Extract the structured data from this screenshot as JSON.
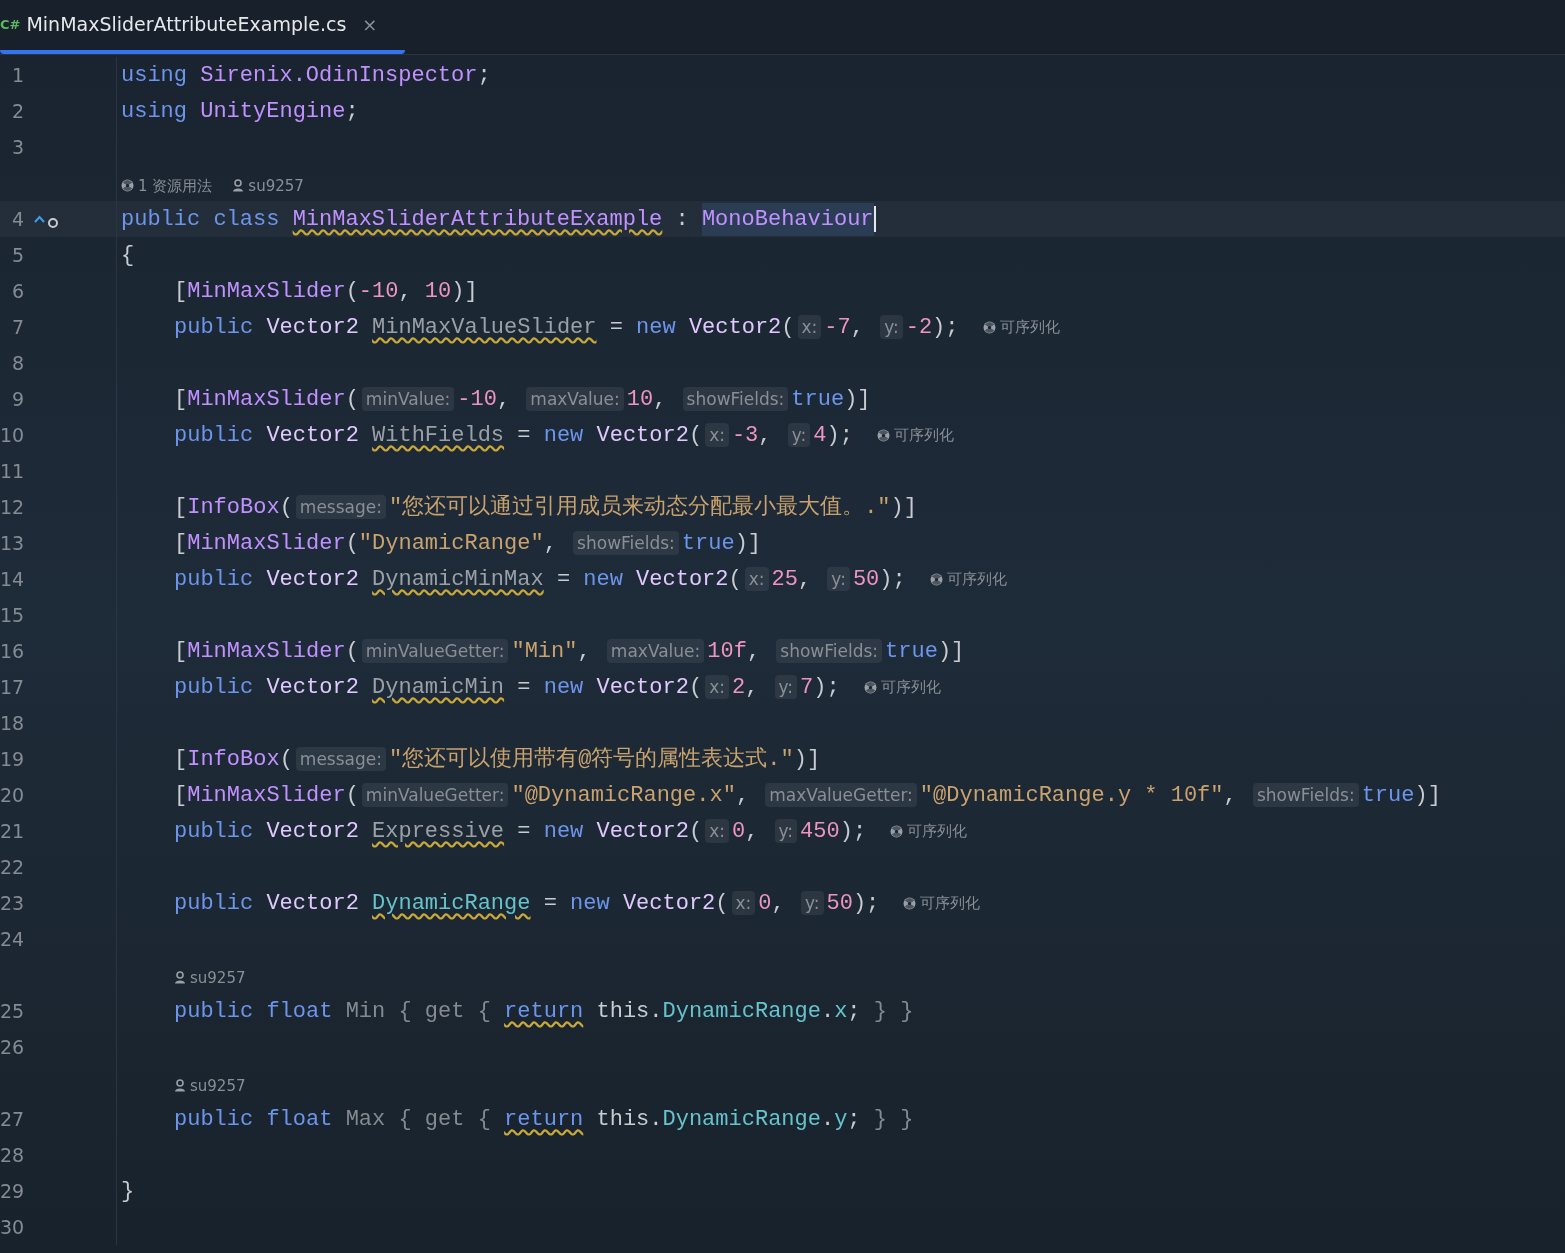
{
  "tab": {
    "icon_text": "C#",
    "title": "MinMaxSliderAttributeExample.cs",
    "close": "×",
    "selected": true
  },
  "rows": [
    {
      "kind": "code",
      "number": "1",
      "tokens": [
        {
          "kind": "keyword",
          "text": "using "
        },
        {
          "kind": "type",
          "text": "Sirenix.OdinInspector"
        },
        {
          "kind": "plain",
          "text": ";"
        }
      ]
    },
    {
      "kind": "code",
      "number": "2",
      "tokens": [
        {
          "kind": "keyword",
          "text": "using "
        },
        {
          "kind": "type",
          "text": "UnityEngine"
        },
        {
          "kind": "plain",
          "text": ";"
        }
      ]
    },
    {
      "kind": "code",
      "number": "3",
      "tokens": []
    },
    {
      "kind": "lens",
      "items": [
        {
          "kind": "usages",
          "text": "1 资源用法"
        },
        {
          "kind": "author",
          "text": "su9257"
        }
      ]
    },
    {
      "kind": "current_code",
      "number": "4",
      "tokens": [
        {
          "kind": "keyword",
          "text": "public class "
        },
        {
          "kind": "type_squiggle",
          "text": "MinMaxSliderAttributeExample"
        },
        {
          "kind": "plain",
          "text": " : "
        },
        {
          "kind": "type_highlight",
          "text": "MonoBehaviour"
        }
      ]
    },
    {
      "kind": "code",
      "number": "5",
      "tokens": [
        {
          "kind": "plain",
          "text": "{"
        }
      ]
    },
    {
      "kind": "indented_code",
      "number": "6",
      "tokens": [
        {
          "kind": "plain",
          "text": "["
        },
        {
          "kind": "type",
          "text": "MinMaxSlider"
        },
        {
          "kind": "plain",
          "text": "("
        },
        {
          "kind": "number",
          "text": "-10"
        },
        {
          "kind": "plain",
          "text": ", "
        },
        {
          "kind": "number",
          "text": "10"
        },
        {
          "kind": "plain",
          "text": ")]"
        }
      ]
    },
    {
      "kind": "indented_code",
      "number": "7",
      "tokens": [
        {
          "kind": "keyword",
          "text": "public "
        },
        {
          "kind": "struct",
          "text": "Vector2 "
        },
        {
          "kind": "field_squiggle",
          "text": "MinMaxValueSlider"
        },
        {
          "kind": "plain",
          "text": " = "
        },
        {
          "kind": "keyword",
          "text": "new "
        },
        {
          "kind": "struct",
          "text": "Vector2"
        },
        {
          "kind": "plain",
          "text": "("
        },
        {
          "kind": "hint",
          "text": "x:"
        },
        {
          "kind": "number",
          "text": "-7"
        },
        {
          "kind": "plain",
          "text": ", "
        },
        {
          "kind": "hint",
          "text": "y:"
        },
        {
          "kind": "number",
          "text": "-2"
        },
        {
          "kind": "plain",
          "text": ");"
        },
        {
          "kind": "lens",
          "text": "可序列化"
        }
      ]
    },
    {
      "kind": "code",
      "number": "8",
      "tokens": []
    },
    {
      "kind": "indented_code",
      "number": "9",
      "tokens": [
        {
          "kind": "plain",
          "text": "["
        },
        {
          "kind": "type",
          "text": "MinMaxSlider"
        },
        {
          "kind": "plain",
          "text": "("
        },
        {
          "kind": "hint",
          "text": "minValue:"
        },
        {
          "kind": "number",
          "text": "-10"
        },
        {
          "kind": "plain",
          "text": ", "
        },
        {
          "kind": "hint",
          "text": "maxValue:"
        },
        {
          "kind": "number",
          "text": "10"
        },
        {
          "kind": "plain",
          "text": ", "
        },
        {
          "kind": "hint",
          "text": "showFields:"
        },
        {
          "kind": "keyword",
          "text": "true"
        },
        {
          "kind": "plain",
          "text": ")]"
        }
      ]
    },
    {
      "kind": "indented_code",
      "number": "10",
      "tokens": [
        {
          "kind": "keyword",
          "text": "public "
        },
        {
          "kind": "struct",
          "text": "Vector2 "
        },
        {
          "kind": "field_squiggle",
          "text": "WithFields"
        },
        {
          "kind": "plain",
          "text": " = "
        },
        {
          "kind": "keyword",
          "text": "new "
        },
        {
          "kind": "struct",
          "text": "Vector2"
        },
        {
          "kind": "plain",
          "text": "("
        },
        {
          "kind": "hint",
          "text": "x:"
        },
        {
          "kind": "number",
          "text": "-3"
        },
        {
          "kind": "plain",
          "text": ", "
        },
        {
          "kind": "hint",
          "text": "y:"
        },
        {
          "kind": "number",
          "text": "4"
        },
        {
          "kind": "plain",
          "text": ");"
        },
        {
          "kind": "lens",
          "text": "可序列化"
        }
      ]
    },
    {
      "kind": "code",
      "number": "11",
      "tokens": []
    },
    {
      "kind": "indented_code",
      "number": "12",
      "tokens": [
        {
          "kind": "plain",
          "text": "["
        },
        {
          "kind": "type",
          "text": "InfoBox"
        },
        {
          "kind": "plain",
          "text": "("
        },
        {
          "kind": "hint",
          "text": "message:"
        },
        {
          "kind": "string",
          "text": "\"您还可以通过引用成员来动态分配最小最大值。.\""
        },
        {
          "kind": "plain",
          "text": ")]"
        }
      ]
    },
    {
      "kind": "indented_code",
      "number": "13",
      "tokens": [
        {
          "kind": "plain",
          "text": "["
        },
        {
          "kind": "type",
          "text": "MinMaxSlider"
        },
        {
          "kind": "plain",
          "text": "("
        },
        {
          "kind": "string",
          "text": "\"DynamicRange\""
        },
        {
          "kind": "plain",
          "text": ", "
        },
        {
          "kind": "hint",
          "text": "showFields:"
        },
        {
          "kind": "keyword",
          "text": "true"
        },
        {
          "kind": "plain",
          "text": ")]"
        }
      ]
    },
    {
      "kind": "indented_code",
      "number": "14",
      "tokens": [
        {
          "kind": "keyword",
          "text": "public "
        },
        {
          "kind": "struct",
          "text": "Vector2 "
        },
        {
          "kind": "field_squiggle",
          "text": "DynamicMinMax"
        },
        {
          "kind": "plain",
          "text": " = "
        },
        {
          "kind": "keyword",
          "text": "new "
        },
        {
          "kind": "struct",
          "text": "Vector2"
        },
        {
          "kind": "plain",
          "text": "("
        },
        {
          "kind": "hint",
          "text": "x:"
        },
        {
          "kind": "number",
          "text": "25"
        },
        {
          "kind": "plain",
          "text": ", "
        },
        {
          "kind": "hint",
          "text": "y:"
        },
        {
          "kind": "number",
          "text": "50"
        },
        {
          "kind": "plain",
          "text": ");"
        },
        {
          "kind": "lens",
          "text": "可序列化"
        }
      ]
    },
    {
      "kind": "code",
      "number": "15",
      "tokens": []
    },
    {
      "kind": "indented_code",
      "number": "16",
      "tokens": [
        {
          "kind": "plain",
          "text": "["
        },
        {
          "kind": "type",
          "text": "MinMaxSlider"
        },
        {
          "kind": "plain",
          "text": "("
        },
        {
          "kind": "hint",
          "text": "minValueGetter:"
        },
        {
          "kind": "string",
          "text": "\"Min\""
        },
        {
          "kind": "plain",
          "text": ", "
        },
        {
          "kind": "hint",
          "text": "maxValue:"
        },
        {
          "kind": "number",
          "text": "10f"
        },
        {
          "kind": "plain",
          "text": ", "
        },
        {
          "kind": "hint",
          "text": "showFields:"
        },
        {
          "kind": "keyword",
          "text": "true"
        },
        {
          "kind": "plain",
          "text": ")]"
        }
      ]
    },
    {
      "kind": "indented_code",
      "number": "17",
      "tokens": [
        {
          "kind": "keyword",
          "text": "public "
        },
        {
          "kind": "struct",
          "text": "Vector2 "
        },
        {
          "kind": "field_squiggle",
          "text": "DynamicMin"
        },
        {
          "kind": "plain",
          "text": " = "
        },
        {
          "kind": "keyword",
          "text": "new "
        },
        {
          "kind": "struct",
          "text": "Vector2"
        },
        {
          "kind": "plain",
          "text": "("
        },
        {
          "kind": "hint",
          "text": "x:"
        },
        {
          "kind": "number",
          "text": "2"
        },
        {
          "kind": "plain",
          "text": ", "
        },
        {
          "kind": "hint",
          "text": "y:"
        },
        {
          "kind": "number",
          "text": "7"
        },
        {
          "kind": "plain",
          "text": ");"
        },
        {
          "kind": "lens",
          "text": "可序列化"
        }
      ]
    },
    {
      "kind": "code",
      "number": "18",
      "tokens": []
    },
    {
      "kind": "indented_code",
      "number": "19",
      "tokens": [
        {
          "kind": "plain",
          "text": "["
        },
        {
          "kind": "type",
          "text": "InfoBox"
        },
        {
          "kind": "plain",
          "text": "("
        },
        {
          "kind": "hint",
          "text": "message:"
        },
        {
          "kind": "string",
          "text": "\"您还可以使用带有@符号的属性表达式.\""
        },
        {
          "kind": "plain",
          "text": ")]"
        }
      ]
    },
    {
      "kind": "indented_code",
      "number": "20",
      "tokens": [
        {
          "kind": "plain",
          "text": "["
        },
        {
          "kind": "type",
          "text": "MinMaxSlider"
        },
        {
          "kind": "plain",
          "text": "("
        },
        {
          "kind": "hint",
          "text": "minValueGetter:"
        },
        {
          "kind": "string",
          "text": "\"@DynamicRange.x\""
        },
        {
          "kind": "plain",
          "text": ", "
        },
        {
          "kind": "hint",
          "text": "maxValueGetter:"
        },
        {
          "kind": "string",
          "text": "\"@DynamicRange.y * 10f\""
        },
        {
          "kind": "plain",
          "text": ", "
        },
        {
          "kind": "hint",
          "text": "showFields:"
        },
        {
          "kind": "keyword",
          "text": "true"
        },
        {
          "kind": "plain",
          "text": ")]"
        }
      ]
    },
    {
      "kind": "indented_code",
      "number": "21",
      "tokens": [
        {
          "kind": "keyword",
          "text": "public "
        },
        {
          "kind": "struct",
          "text": "Vector2 "
        },
        {
          "kind": "field_squiggle",
          "text": "Expressive"
        },
        {
          "kind": "plain",
          "text": " = "
        },
        {
          "kind": "keyword",
          "text": "new "
        },
        {
          "kind": "struct",
          "text": "Vector2"
        },
        {
          "kind": "plain",
          "text": "("
        },
        {
          "kind": "hint",
          "text": "x:"
        },
        {
          "kind": "number",
          "text": "0"
        },
        {
          "kind": "plain",
          "text": ", "
        },
        {
          "kind": "hint",
          "text": "y:"
        },
        {
          "kind": "number",
          "text": "450"
        },
        {
          "kind": "plain",
          "text": ");"
        },
        {
          "kind": "lens",
          "text": "可序列化"
        }
      ]
    },
    {
      "kind": "code",
      "number": "22",
      "tokens": []
    },
    {
      "kind": "indented_code",
      "number": "23",
      "tokens": [
        {
          "kind": "keyword",
          "text": "public "
        },
        {
          "kind": "struct",
          "text": "Vector2 "
        },
        {
          "kind": "member_squiggle",
          "text": "DynamicRange"
        },
        {
          "kind": "plain",
          "text": " = "
        },
        {
          "kind": "keyword",
          "text": "new "
        },
        {
          "kind": "struct",
          "text": "Vector2"
        },
        {
          "kind": "plain",
          "text": "("
        },
        {
          "kind": "hint",
          "text": "x:"
        },
        {
          "kind": "number",
          "text": "0"
        },
        {
          "kind": "plain",
          "text": ", "
        },
        {
          "kind": "hint",
          "text": "y:"
        },
        {
          "kind": "number",
          "text": "50"
        },
        {
          "kind": "plain",
          "text": ");"
        },
        {
          "kind": "lens",
          "text": "可序列化"
        }
      ]
    },
    {
      "kind": "code",
      "number": "24",
      "tokens": []
    },
    {
      "kind": "indented_lens",
      "items": [
        {
          "kind": "author",
          "text": "su9257"
        }
      ]
    },
    {
      "kind": "indented_code",
      "number": "25",
      "tokens": [
        {
          "kind": "keyword",
          "text": "public float "
        },
        {
          "kind": "muted",
          "text": "Min { get { "
        },
        {
          "kind": "keyword_squiggle",
          "text": "return"
        },
        {
          "kind": "plain",
          "text": " this."
        },
        {
          "kind": "member",
          "text": "DynamicRange"
        },
        {
          "kind": "plain",
          "text": "."
        },
        {
          "kind": "member",
          "text": "x"
        },
        {
          "kind": "plain",
          "text": ";"
        },
        {
          "kind": "muted",
          "text": " } }"
        }
      ]
    },
    {
      "kind": "code",
      "number": "26",
      "tokens": []
    },
    {
      "kind": "indented_lens",
      "items": [
        {
          "kind": "author",
          "text": "su9257"
        }
      ]
    },
    {
      "kind": "indented_code",
      "number": "27",
      "tokens": [
        {
          "kind": "keyword",
          "text": "public float "
        },
        {
          "kind": "muted",
          "text": "Max { get { "
        },
        {
          "kind": "keyword_squiggle",
          "text": "return"
        },
        {
          "kind": "plain",
          "text": " this."
        },
        {
          "kind": "member",
          "text": "DynamicRange"
        },
        {
          "kind": "plain",
          "text": "."
        },
        {
          "kind": "member",
          "text": "y"
        },
        {
          "kind": "plain",
          "text": ";"
        },
        {
          "kind": "muted",
          "text": " } }"
        }
      ]
    },
    {
      "kind": "code",
      "number": "28",
      "tokens": []
    },
    {
      "kind": "code",
      "number": "29",
      "tokens": [
        {
          "kind": "plain",
          "text": "}"
        }
      ]
    },
    {
      "kind": "code",
      "number": "30",
      "tokens": []
    }
  ]
}
